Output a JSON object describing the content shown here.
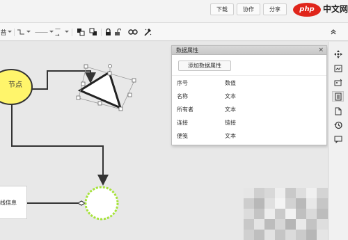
{
  "header": {
    "buttons": [
      "下载",
      "协作",
      "分享"
    ],
    "brand": {
      "logo": "php",
      "text": "中文网"
    }
  },
  "toolbar": {
    "font_partial": "苔",
    "line_style": "———",
    "arrow_style": "—→"
  },
  "canvas": {
    "node_label": "节点",
    "textbox_label": "线信息"
  },
  "panel": {
    "title": "数据属性",
    "close": "×",
    "add_button": "添加数据属性",
    "rows": [
      {
        "name": "序号",
        "type": "数值"
      },
      {
        "name": "名称",
        "type": "文本"
      },
      {
        "name": "所有者",
        "type": "文本"
      },
      {
        "name": "连接",
        "type": "链接"
      },
      {
        "name": "便笺",
        "type": "文本"
      }
    ]
  },
  "colors": {
    "node_fill": "#fff56b",
    "circle_border": "#a6e33a",
    "panel_head": "#d0d0d0"
  }
}
